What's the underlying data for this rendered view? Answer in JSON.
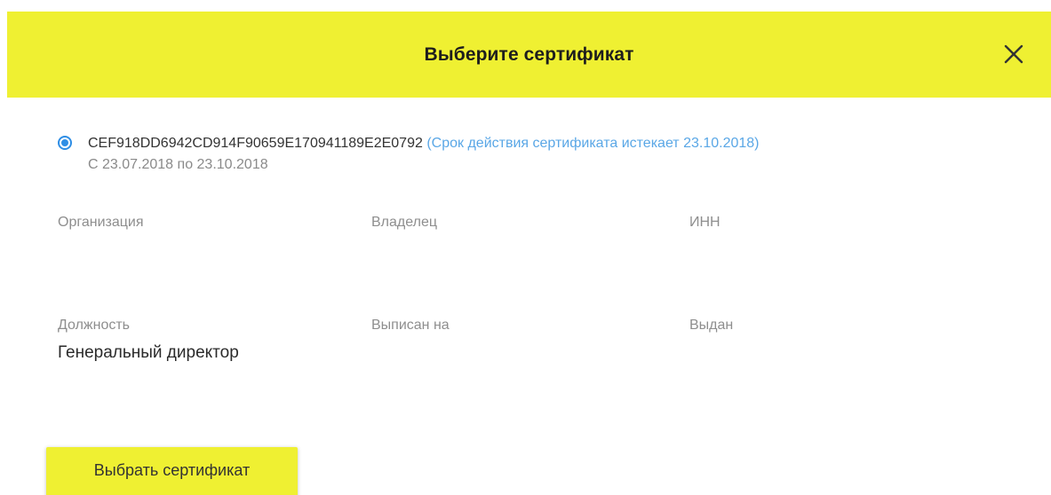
{
  "header": {
    "title": "Выберите сертификат",
    "close_icon": "close-icon"
  },
  "certificate": {
    "selected": true,
    "id": "CEF918DD6942CD914F90659E170941189E2E0792",
    "expiry_note": "(Срок действия сертификата истекает 23.10.2018)",
    "validity": "С 23.07.2018 по 23.10.2018"
  },
  "fields": {
    "organization": {
      "label": "Организация",
      "value": ""
    },
    "owner": {
      "label": "Владелец",
      "value": ""
    },
    "inn": {
      "label": "ИНН",
      "value": ""
    },
    "position": {
      "label": "Должность",
      "value": "Генеральный директор"
    },
    "issued_to": {
      "label": "Выписан на",
      "value": ""
    },
    "issued_by": {
      "label": "Выдан",
      "value": ""
    }
  },
  "actions": {
    "select_label": "Выбрать сертификат"
  },
  "colors": {
    "accent_yellow": "#eff032",
    "radio_blue": "#2f8ee5",
    "link_blue": "#5aa7e6",
    "label_gray": "#8e8e8e"
  }
}
